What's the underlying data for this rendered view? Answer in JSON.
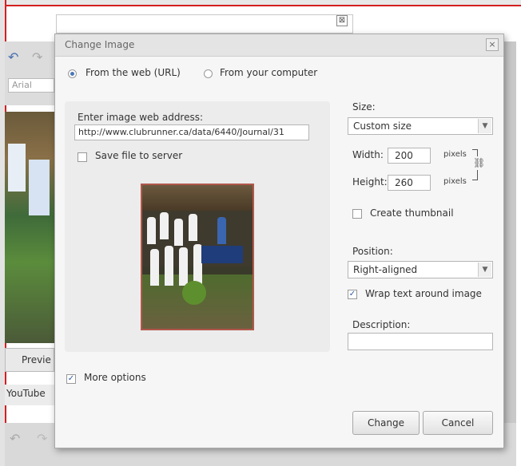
{
  "background": {
    "font_value": "Arial",
    "preview_tab": "Previe",
    "youtube_tab": "YouTube",
    "urlbar_close": "⊠"
  },
  "dialog": {
    "title": "Change Image",
    "close_icon": "close-icon",
    "source": {
      "web_label": "From the web (URL)",
      "computer_label": "From your computer",
      "selected": "web"
    },
    "web_address_label": "Enter image web address:",
    "web_address_value": "http://www.clubrunner.ca/data/6440/Journal/31",
    "save_to_server_label": "Save file to server",
    "save_to_server_checked": false,
    "size_label": "Size:",
    "size_value": "Custom size",
    "width_label": "Width:",
    "width_value": "200",
    "width_unit": "pixels",
    "height_label": "Height:",
    "height_value": "260",
    "height_unit": "pixels",
    "create_thumbnail_label": "Create thumbnail",
    "create_thumbnail_checked": false,
    "position_label": "Position:",
    "position_value": "Right-aligned",
    "wrap_text_label": "Wrap text around image",
    "wrap_text_checked": true,
    "description_label": "Description:",
    "description_value": "",
    "more_options_label": "More options",
    "more_options_checked": true,
    "change_button": "Change",
    "cancel_button": "Cancel"
  },
  "colors": {
    "frame_red": "#d31f1f",
    "radio_blue": "#4a78b8",
    "image_border": "#b1584b"
  }
}
